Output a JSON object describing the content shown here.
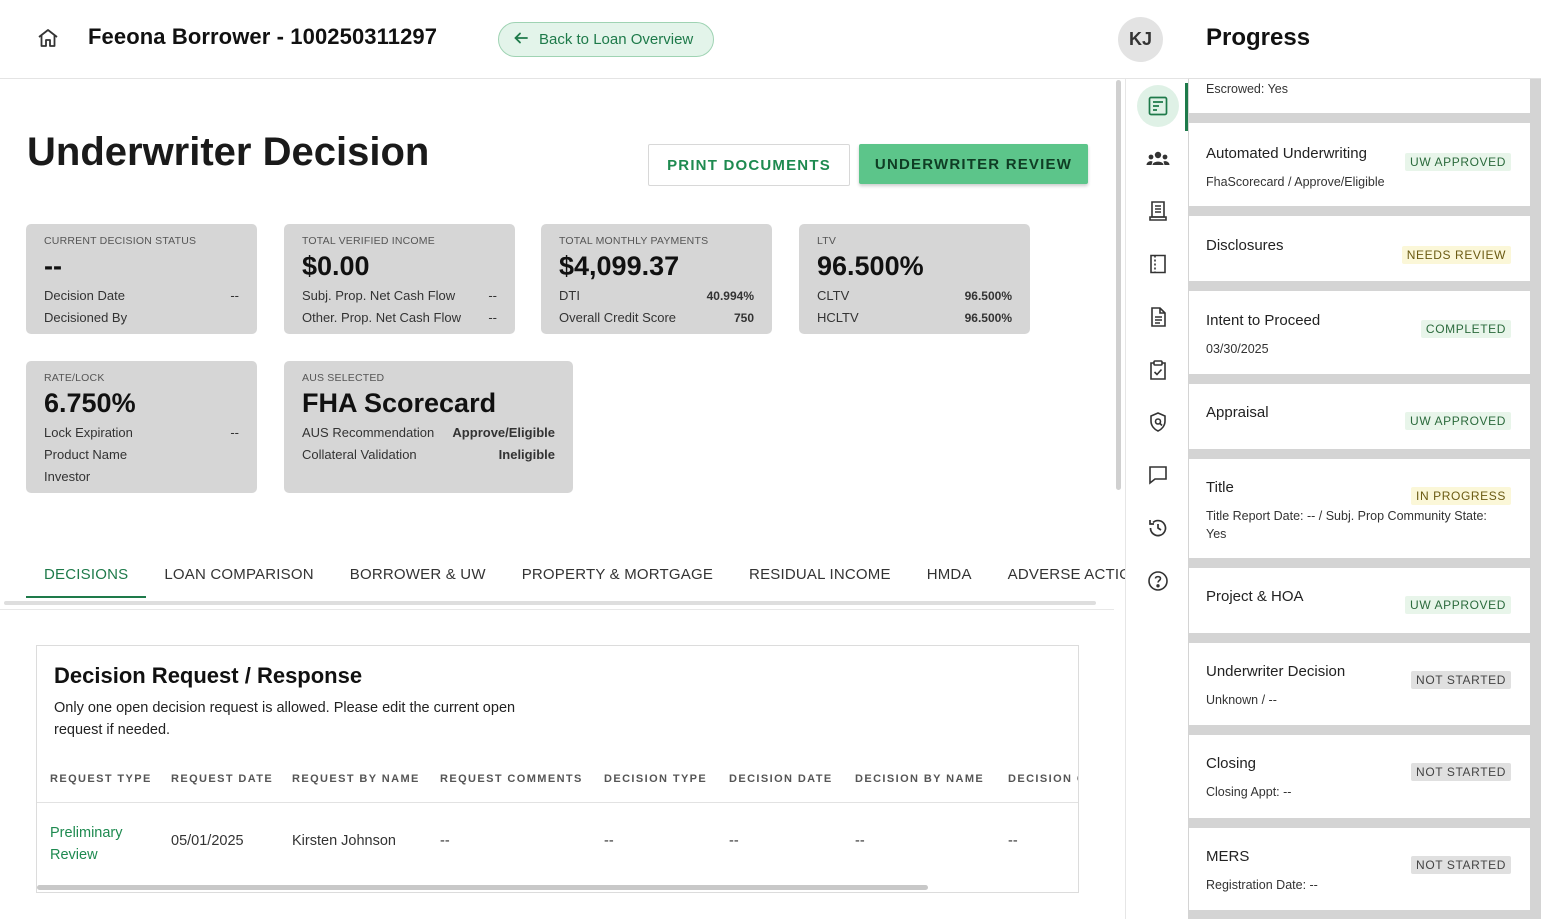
{
  "header": {
    "loan_title": "Feeona Borrower - 100250311297",
    "back_label": "Back to Loan Overview",
    "avatar_initials": "KJ"
  },
  "page": {
    "title": "Underwriter Decision",
    "print_label": "PRINT DOCUMENTS",
    "review_label": "UNDERWRITER REVIEW"
  },
  "cards": {
    "status": {
      "label": "CURRENT DECISION STATUS",
      "value": "--",
      "rows": [
        {
          "k": "Decision Date",
          "v": "--"
        },
        {
          "k": "Decisioned By",
          "v": ""
        }
      ]
    },
    "income": {
      "label": "TOTAL VERIFIED INCOME",
      "value": "$0.00",
      "rows": [
        {
          "k": "Subj. Prop. Net Cash Flow",
          "v": "--"
        },
        {
          "k": "Other. Prop. Net Cash Flow",
          "v": "--"
        }
      ]
    },
    "payments": {
      "label": "TOTAL MONTHLY PAYMENTS",
      "value": "$4,099.37",
      "rows": [
        {
          "k": "DTI",
          "v": "40.994%"
        },
        {
          "k": "Overall Credit Score",
          "v": "750"
        }
      ]
    },
    "ltv": {
      "label": "LTV",
      "value": "96.500%",
      "rows": [
        {
          "k": "CLTV",
          "v": "96.500%"
        },
        {
          "k": "HCLTV",
          "v": "96.500%"
        }
      ]
    },
    "rate": {
      "label": "RATE/LOCK",
      "value": "6.750%",
      "rows": [
        {
          "k": "Lock Expiration",
          "v": "--"
        },
        {
          "k": "Product Name",
          "v": ""
        },
        {
          "k": "Investor",
          "v": ""
        }
      ]
    },
    "aus": {
      "label": "AUS SELECTED",
      "value": "FHA Scorecard",
      "rows": [
        {
          "k": "AUS Recommendation",
          "v": "Approve/Eligible"
        },
        {
          "k": "Collateral Validation",
          "v": "Ineligible"
        }
      ]
    }
  },
  "tabs": [
    "DECISIONS",
    "LOAN COMPARISON",
    "BORROWER & UW",
    "PROPERTY & MORTGAGE",
    "RESIDUAL INCOME",
    "HMDA",
    "ADVERSE ACTION"
  ],
  "decision": {
    "title": "Decision Request / Response",
    "note": "Only one open decision request is allowed. Please edit the current open request if needed.",
    "columns": [
      "REQUEST TYPE",
      "REQUEST DATE",
      "REQUEST BY NAME",
      "REQUEST COMMENTS",
      "DECISION TYPE",
      "DECISION DATE",
      "DECISION BY NAME",
      "DECISION C"
    ],
    "rows": [
      [
        "Preliminary Review",
        "05/01/2025",
        "Kirsten Johnson",
        "--",
        "--",
        "--",
        "--",
        "--"
      ]
    ]
  },
  "rail_icons": [
    "checklist-icon",
    "users-icon",
    "receipt-icon",
    "document-corner-icon",
    "file-text-icon",
    "clipboard-check-icon",
    "shield-search-icon",
    "chat-icon",
    "history-icon",
    "help-icon"
  ],
  "progress": {
    "title": "Progress",
    "items": [
      {
        "title": "",
        "sub": "Escrowed: Yes",
        "badge": "",
        "tone": ""
      },
      {
        "title": "Automated Underwriting",
        "sub": "FhaScorecard / Approve/Eligible",
        "badge": "UW APPROVED",
        "tone": "green"
      },
      {
        "title": "Disclosures",
        "sub": "",
        "badge": "NEEDS REVIEW",
        "tone": "yellow"
      },
      {
        "title": "Intent to Proceed",
        "sub": "03/30/2025",
        "badge": "COMPLETED",
        "tone": "green"
      },
      {
        "title": "Appraisal",
        "sub": "",
        "badge": "UW APPROVED",
        "tone": "green"
      },
      {
        "title": "Title",
        "sub": "Title Report Date: -- / Subj. Prop Community State: Yes",
        "badge": "IN PROGRESS",
        "tone": "yellow"
      },
      {
        "title": "Project & HOA",
        "sub": "",
        "badge": "UW APPROVED",
        "tone": "green"
      },
      {
        "title": "Underwriter Decision",
        "sub": "Unknown / --",
        "badge": "NOT STARTED",
        "tone": "gray"
      },
      {
        "title": "Closing",
        "sub": "Closing Appt: --",
        "badge": "NOT STARTED",
        "tone": "gray"
      },
      {
        "title": "MERS",
        "sub": "Registration Date: --",
        "badge": "NOT STARTED",
        "tone": "gray"
      }
    ]
  }
}
